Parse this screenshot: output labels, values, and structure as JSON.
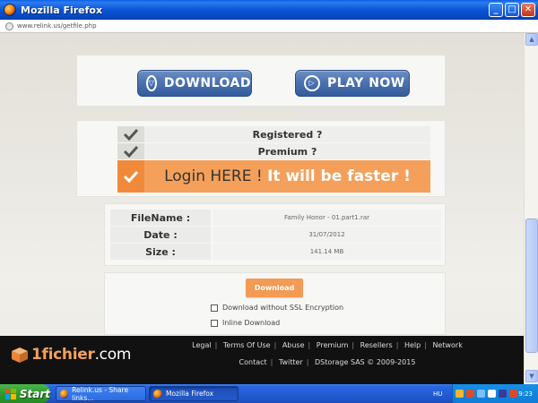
{
  "window": {
    "title": "Mozilla Firefox",
    "minimize": "_",
    "maximize": "□",
    "close": "✕"
  },
  "address_bar": {
    "url": "www.relink.us/getfile.php"
  },
  "buttons": {
    "download": "DOWNLOAD",
    "play_now": "PLAY NOW"
  },
  "account_options": {
    "registered": "Registered ?",
    "premium": "Premium ?",
    "login_prefix": "Login HERE ! ",
    "login_emphasis": "It will be faster !"
  },
  "file_info": {
    "rows": [
      {
        "label": "FileName :",
        "value": "Family Honor - 01.part1.rar"
      },
      {
        "label": "Date :",
        "value": "31/07/2012"
      },
      {
        "label": "Size :",
        "value": "141.14 MB"
      }
    ]
  },
  "download_form": {
    "button_label": "Download",
    "options": [
      {
        "label": "Download without SSL Encryption",
        "checked": false
      },
      {
        "label": "Inline Download",
        "checked": false
      }
    ]
  },
  "footer": {
    "brand_name": "1fichier",
    "brand_tld": ".com",
    "row1": [
      "Legal",
      "Terms Of Use",
      "Abuse",
      "Premium",
      "Resellers",
      "Help",
      "Network"
    ],
    "row2": [
      "Contact",
      "Twitter",
      "DStorage SAS © 2009-2015"
    ]
  },
  "taskbar": {
    "start_label": "Start",
    "tasks": [
      "Relink.us - Share links...",
      "Mozilla Firefox"
    ],
    "language": "HU",
    "clock": "9:23"
  },
  "colors": {
    "accent_orange": "#f5a05a",
    "button_blue": "#4c73b1",
    "footer_bg": "#111111",
    "brand_orange": "#f4a05b"
  }
}
